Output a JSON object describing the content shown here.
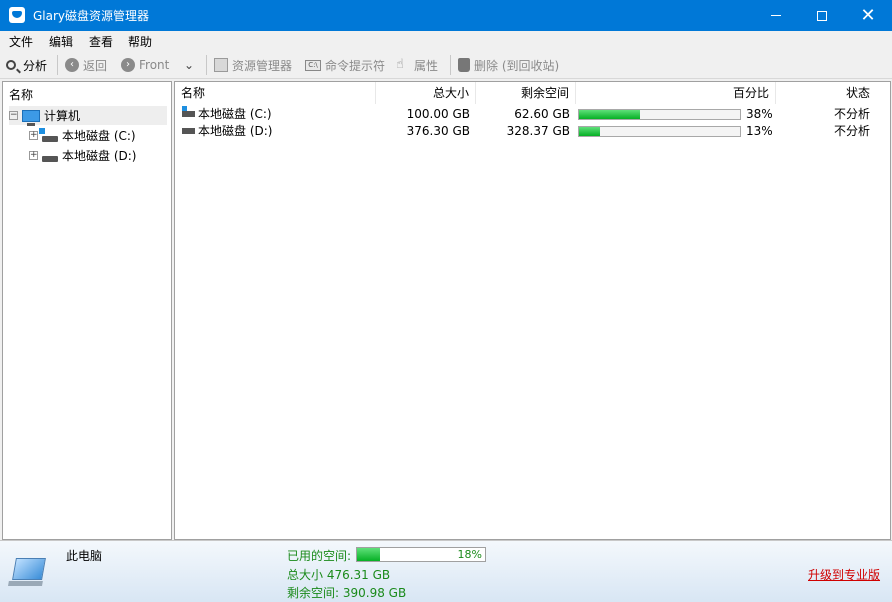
{
  "window": {
    "title": "Glary磁盘资源管理器"
  },
  "menu": [
    "文件",
    "编辑",
    "查看",
    "帮助"
  ],
  "toolbar": {
    "analyze": "分析",
    "back": "返回",
    "forward": "Front",
    "explorer": "资源管理器",
    "cmd": "命令提示符",
    "properties": "属性",
    "delete": "删除 (到回收站)"
  },
  "tree": {
    "header": "名称",
    "root": "计算机",
    "items": [
      "本地磁盘 (C:)",
      "本地磁盘 (D:)"
    ]
  },
  "list": {
    "columns": [
      "名称",
      "总大小",
      "剩余空间",
      "百分比",
      "状态"
    ],
    "rows": [
      {
        "name": "本地磁盘 (C:)",
        "total": "100.00 GB",
        "free": "62.60 GB",
        "percent": "38%",
        "fill": 38,
        "status": "不分析"
      },
      {
        "name": "本地磁盘 (D:)",
        "total": "376.30 GB",
        "free": "328.37 GB",
        "percent": "13%",
        "fill": 13,
        "status": "不分析"
      }
    ]
  },
  "status": {
    "label": "此电脑",
    "used_label": "已用的空间:",
    "used_percent": "18%",
    "used_fill": 18,
    "total": "总大小 476.31 GB",
    "free": "剩余空间: 390.98 GB",
    "upgrade": "升级到专业版"
  },
  "colors": {
    "titlebar": "#0078d7",
    "progress": "#06b025",
    "upgrade": "#d00000"
  }
}
